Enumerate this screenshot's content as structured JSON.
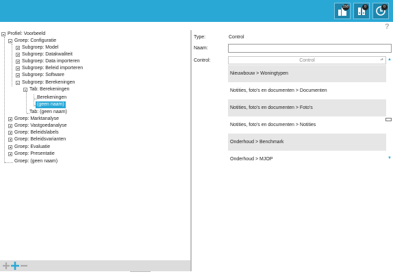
{
  "toolbar": {
    "buttons": [
      {
        "icon": "buildings-icon",
        "badge": "158"
      },
      {
        "icon": "binders-icon",
        "badge": "0"
      },
      {
        "icon": "clock-icon",
        "badge": "0"
      }
    ],
    "help": "?"
  },
  "tree": {
    "root": "Profiel: Voorbeeld",
    "groep_configuratie": "Groep: Configuratie",
    "sub_model": "Subgroep: Model",
    "sub_datakwaliteit": "Subgroep: Datakwaliteit",
    "sub_data_importeren": "Subgroep: Data importeren",
    "sub_beleid_importeren": "Subgroep: Beleid importeren",
    "sub_software": "Subgroep: Software",
    "sub_berekeningen": "Subgroep: Berekeningen",
    "tab_berekeningen": "Tab: Berekeningen",
    "leaf_berekeningen": "Berekeningen",
    "leaf_geen_naam": "(geen naam)",
    "tab_geen_naam": "Tab: (geen naam)",
    "groep_marktanalyse": "Groep: Marktanalyse",
    "groep_vastgoedanalyse": "Groep: Vastgoedanalyse",
    "groep_beleidslabels": "Groep: Beleidslabels",
    "groep_beleidsvarianten": "Groep: Beleidsvarianten",
    "groep_evaluatie": "Groep: Evaluatie",
    "groep_presentatie": "Groep: Presentatie",
    "groep_geen_naam": "Groep: (geen naam)"
  },
  "form": {
    "type_label": "Type:",
    "type_value": "Control",
    "naam_label": "Naam:",
    "naam_value": "",
    "control_label": "Control:",
    "control_column_header": "Control"
  },
  "control_options": [
    "Nieuwbouw > Woningtypen",
    "Notities, foto's en documenten > Documenten",
    "Notities, foto's en documenten > Foto's",
    "Notities, foto's en documenten > Notities",
    "Onderhoud > Benchmark",
    "Onderhoud > MJOP"
  ],
  "colors": {
    "accent": "#29a8d6",
    "toolbar_button": "#1f86ad",
    "row_alt": "#e6e6e6",
    "bottom_bar": "#dcdcdc"
  }
}
